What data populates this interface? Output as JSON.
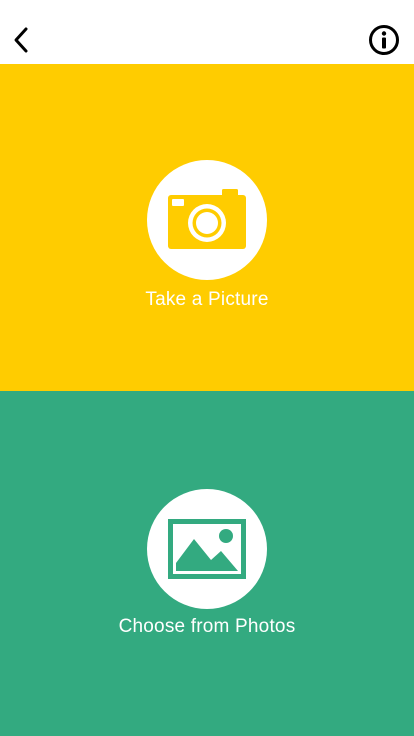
{
  "colors": {
    "camera_panel": "#FFCC00",
    "photos_panel": "#33AA80",
    "navbar": "#FFFFFF",
    "label_text": "#FFFFFF"
  },
  "navbar": {
    "back_icon": "chevron-left-icon",
    "info_icon": "info-circle-icon"
  },
  "camera_option": {
    "icon": "camera-icon",
    "label": "Take a Picture"
  },
  "photos_option": {
    "icon": "photo-gallery-icon",
    "label": "Choose from Photos"
  }
}
